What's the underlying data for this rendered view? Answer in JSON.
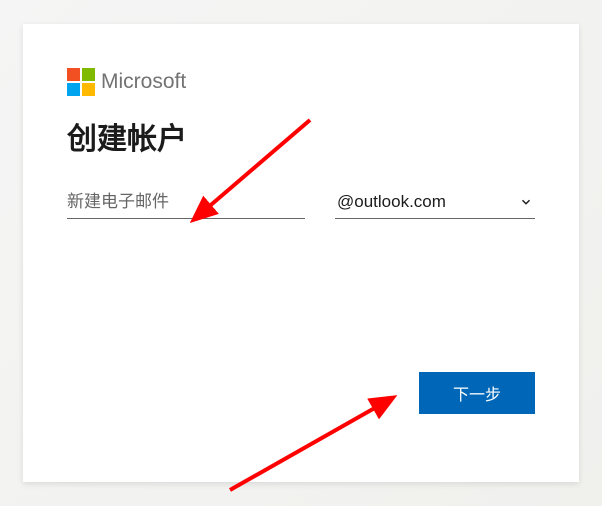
{
  "brand": {
    "name": "Microsoft"
  },
  "form": {
    "title": "创建帐户",
    "email_placeholder": "新建电子邮件",
    "domain_selected": "@outlook.com",
    "next_button": "下一步"
  }
}
